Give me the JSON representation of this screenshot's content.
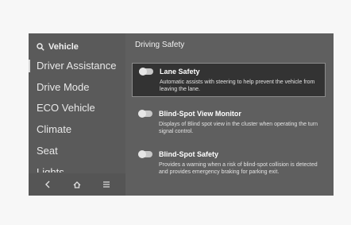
{
  "sidebar": {
    "title": "Vehicle",
    "items": [
      {
        "label": "Driver Assistance"
      },
      {
        "label": "Drive Mode"
      },
      {
        "label": "ECO Vehicle"
      },
      {
        "label": "Climate"
      },
      {
        "label": "Seat"
      },
      {
        "label": "Lights"
      }
    ],
    "bottom_icons": [
      "back-icon",
      "home-icon",
      "menu-icon"
    ]
  },
  "content": {
    "title": "Driving Safety",
    "options": [
      {
        "title": "Lane Safety",
        "description": "Automatic assists with steering to help prevent the vehicle from leaving the lane.",
        "enabled": false,
        "selected": true
      },
      {
        "title": "Blind-Spot View Monitor",
        "description": "Displays of Blind spot view in the cluster when operating the turn signal control.",
        "enabled": false,
        "selected": false
      },
      {
        "title": "Blind-Spot Safety",
        "description": "Provides a warning when a risk of blind-spot collision is detected and provides emergency braking for parking exit.",
        "enabled": false,
        "selected": false
      }
    ]
  }
}
